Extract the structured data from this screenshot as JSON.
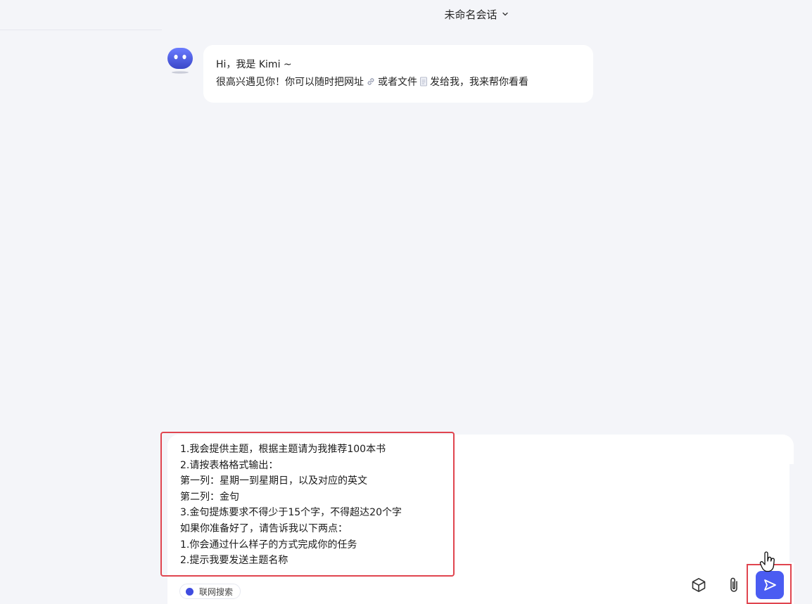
{
  "header": {
    "title": "未命名会话"
  },
  "greeting": {
    "line1": "Hi，我是 Kimi ~",
    "line2_part1": "很高兴遇见你！你可以随时把网址",
    "line2_part2": "或者文件",
    "line2_part3": "发给我，我来帮你看看"
  },
  "input": {
    "lines": [
      "1.我会提供主题，根据主题请为我推荐100本书",
      "2.请按表格格式输出：",
      "第一列：星期一到星期日，以及对应的英文",
      "第二列：金句",
      "3.金句提炼要求不得少于15个字，不得超达20个字",
      "如果你准备好了，请告诉我以下两点：",
      "1.你会通过什么样子的方式完成你的任务",
      "2.提示我要发送主题名称"
    ]
  },
  "toolbar": {
    "web_search_label": "联网搜索",
    "web_search_enabled": true
  },
  "colors": {
    "accent": "#4a5cf2",
    "highlight": "#e0454f",
    "background": "#f4f5f9"
  },
  "icons": [
    "chevron-down-icon",
    "kimi-avatar-icon",
    "link-icon",
    "file-icon",
    "cube-icon",
    "paperclip-icon",
    "send-icon",
    "hand-cursor-icon"
  ]
}
